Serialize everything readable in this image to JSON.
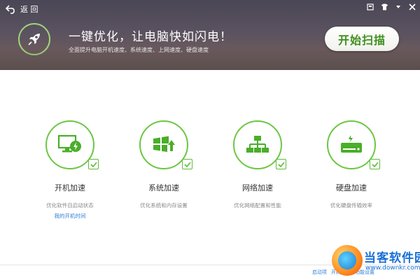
{
  "header": {
    "back_label": "返 回",
    "headline": "一键优化，让电脑快如闪电！",
    "subline": "全面提升电脑开机速度、系统速度、上网速度、硬盘速度",
    "scan_button": "开始扫描",
    "window_controls": [
      "skin-icon",
      "shirt-icon",
      "menu-icon",
      "close-icon"
    ]
  },
  "features": [
    {
      "title": "开机加速",
      "desc": "优化软件自启动状态",
      "link": "我的开机时间",
      "icon": "monitor-power-icon"
    },
    {
      "title": "系统加速",
      "desc": "优化系统和内存设置",
      "link": "",
      "icon": "windows-arrow-icon"
    },
    {
      "title": "网络加速",
      "desc": "优化网络配置和性能",
      "link": "",
      "icon": "network-icon"
    },
    {
      "title": "硬盘加速",
      "desc": "优化硬盘传输效率",
      "link": "",
      "icon": "hard-drive-icon"
    }
  ],
  "footer": {
    "links": [
      "启动项",
      "开机时间",
      "功能设置"
    ]
  },
  "watermark": {
    "title": "当客软件园",
    "url": "www.downkr.com"
  },
  "colors": {
    "accent_green": "#6cc644",
    "button_text": "#3e8f1c",
    "link_blue": "#2e7fd6",
    "watermark_blue": "#1a6fd6"
  }
}
